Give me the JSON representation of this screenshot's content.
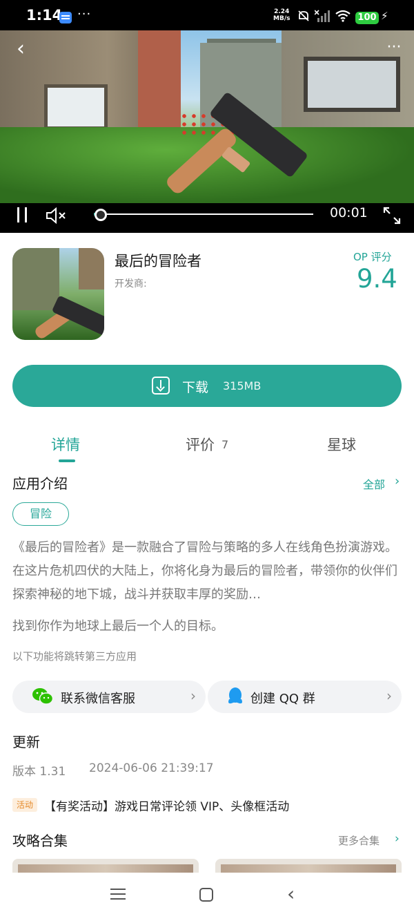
{
  "status_bar": {
    "time": "1:14",
    "more": "···",
    "net_speed_value": "2.24",
    "net_speed_unit": "MB/s",
    "battery": "100",
    "icons": [
      "notification-app-icon",
      "bell-muted-icon",
      "signal-icon",
      "wifi-icon",
      "battery-icon",
      "charging-icon"
    ]
  },
  "video": {
    "elapsed": "00:01",
    "progress_fraction": 0.03,
    "icons": [
      "back-icon",
      "more-icon",
      "pause-icon",
      "mute-icon",
      "fullscreen-icon"
    ]
  },
  "app": {
    "title": "最后的冒险者",
    "developer_label": "开发商:",
    "rating_label": "OP 评分",
    "rating_value": "9.4"
  },
  "download": {
    "label": "下载",
    "size": "315MB"
  },
  "tabs": [
    {
      "label": "详情",
      "active": true
    },
    {
      "label": "评价",
      "count": "7"
    },
    {
      "label": "星球"
    }
  ],
  "intro": {
    "title": "应用介绍",
    "see_all": "全部",
    "tag": "冒险",
    "description": "《最后的冒险者》是一款融合了冒险与策略的多人在线角色扮演游戏。在这片危机四伏的大陆上，你将化身为最后的冒险者，带领你的伙伴们探索神秘的地下城，战斗并获取丰厚的奖励…",
    "extra": "找到你作为地球上最后一个人的目标。",
    "third_party_note": "以下功能将跳转第三方应用"
  },
  "actions": {
    "wechat_label": "联系微信客服",
    "qq_label": "创建 QQ 群"
  },
  "update": {
    "title": "更新",
    "version": "版本 1.31",
    "date": "2024-06-06 21:39:17",
    "activity_tag": "活动",
    "activity_text": "【有奖活动】游戏日常评论领 VIP、头像框活动"
  },
  "guides": {
    "title": "攻略合集",
    "more": "更多合集"
  },
  "colors": {
    "accent": "#2aa898",
    "activity": "#e48a2a"
  }
}
